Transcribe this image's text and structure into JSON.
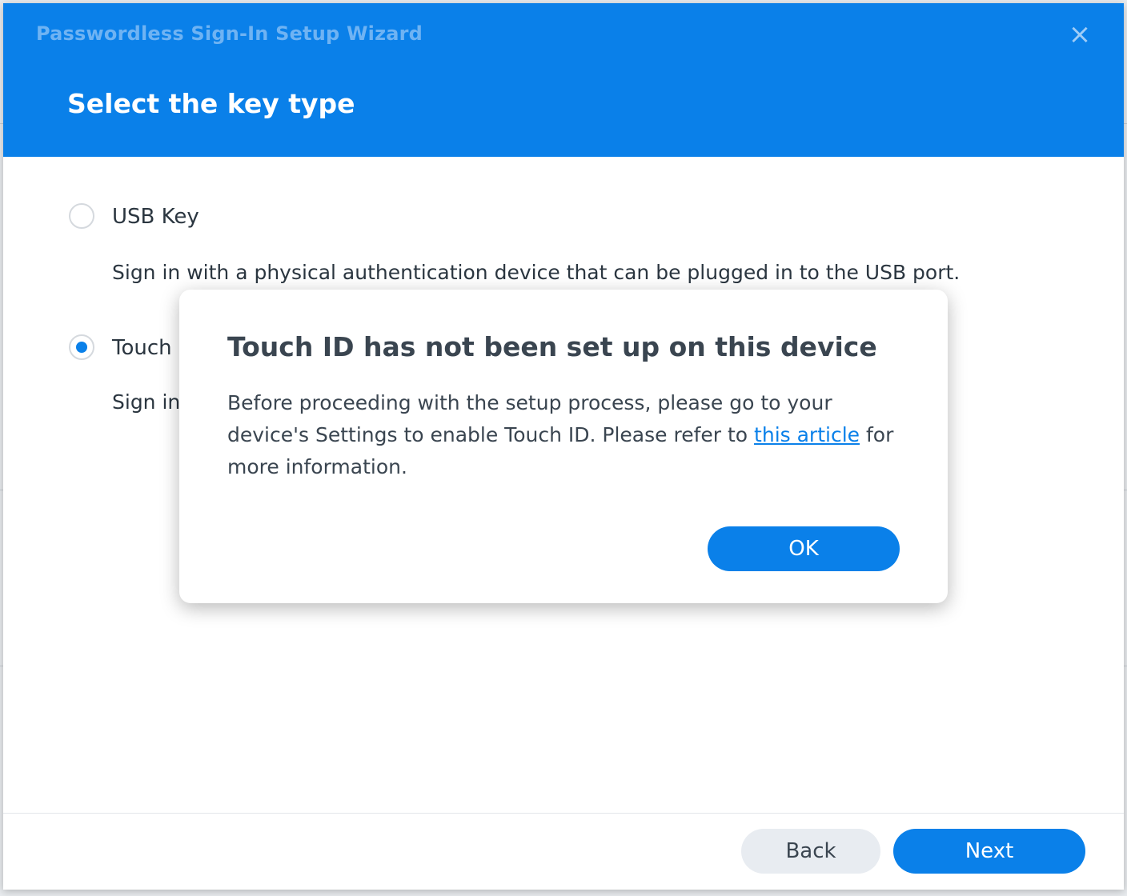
{
  "wizard": {
    "title": "Passwordless Sign-In Setup Wizard",
    "close_icon": "×",
    "step_title": "Select the key type",
    "options": [
      {
        "label": "USB Key",
        "description": "Sign in with a physical authentication device that can be plugged in to the USB port.",
        "selected": false
      },
      {
        "label": "Touch",
        "description": "Sign in",
        "selected": true
      }
    ],
    "back_label": "Back",
    "next_label": "Next"
  },
  "modal": {
    "title": "Touch ID has not been set up on this device",
    "body_before_link": "Before proceeding with the setup process, please go to your device's Settings to enable Touch ID. Please refer to ",
    "link_text": "this article",
    "body_after_link": " for more information.",
    "ok_label": "OK"
  },
  "colors": {
    "accent": "#0a80e9",
    "text": "#2b3640"
  }
}
